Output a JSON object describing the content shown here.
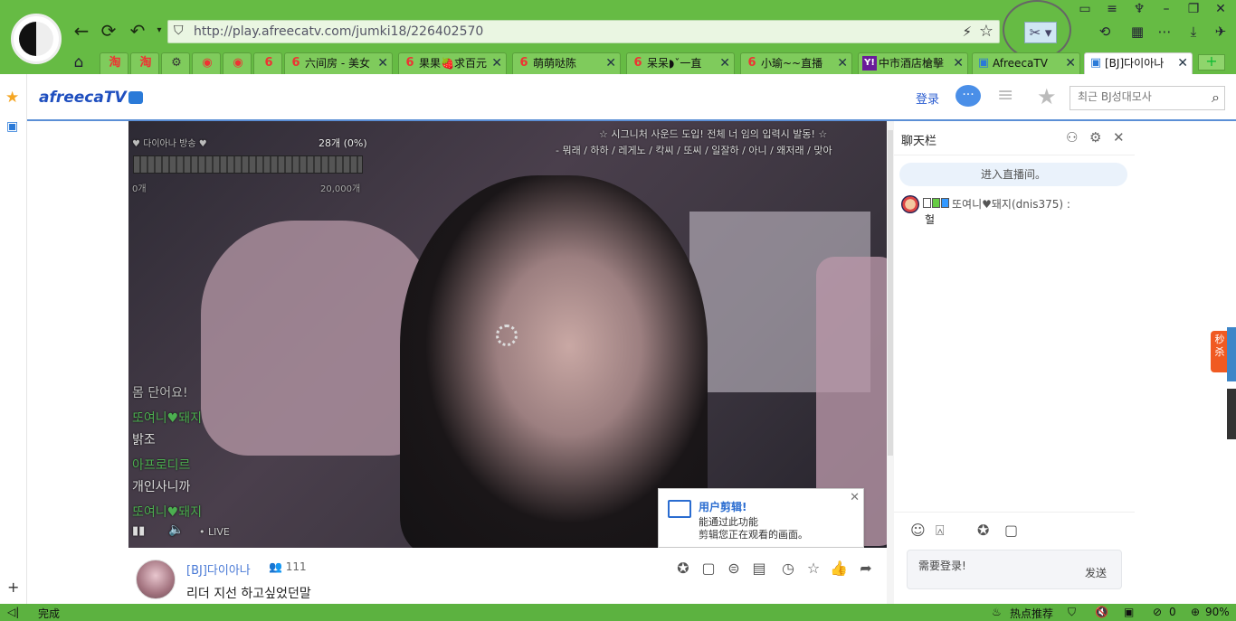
{
  "browser": {
    "url_host": "http://play.afreecatv.com",
    "url_path": "/jumki18/226402570",
    "tabs": [
      {
        "favicon": "taobao-icon",
        "label": "淘"
      },
      {
        "favicon": "taobao-icon",
        "label": "淘"
      },
      {
        "favicon": "gear-icon",
        "label": "⚙"
      },
      {
        "favicon": "weibo-icon",
        "label": "◉"
      },
      {
        "favicon": "weibo-icon",
        "label": "◉"
      },
      {
        "favicon": "six-icon",
        "label": "6"
      },
      {
        "favicon": "six-icon",
        "label": "六间房 - 美女"
      },
      {
        "favicon": "six-icon",
        "label": "果果🍓求百元"
      },
      {
        "favicon": "six-icon",
        "label": "萌萌哒陈"
      },
      {
        "favicon": "six-icon",
        "label": "呆呆◗ˇ一直"
      },
      {
        "favicon": "six-icon",
        "label": "小瑜~~直播"
      },
      {
        "favicon": "yahoo-icon",
        "label": "中市酒店槍擊"
      },
      {
        "favicon": "afreeca-icon",
        "label": "AfreecaTV"
      },
      {
        "favicon": "afreeca-icon",
        "label": "[BJ]다이아나"
      }
    ],
    "new_tab": "+"
  },
  "header": {
    "logo": "afreecaTV",
    "login": "登录",
    "search_placeholder": "최근 BJ성대모사"
  },
  "video": {
    "overlay_top": "☆ 시그니처 사운드 도입! 전체 너 임의 입력시 발동! ☆",
    "overlay_sub": "- 뭐래 / 하하 / 레게노 / 칵씨 / 또씨 / 일잘하 / 아니 / 왜저래 / 맞아",
    "goal_title": "♥ 다이아나 방송 ♥",
    "goal_count": "28개 (0%)",
    "goal_min": "0개",
    "goal_max": "20,000개",
    "chat_lines": [
      {
        "text": "몸 단어요!",
        "color": "#ccc"
      },
      {
        "text": "또여니♥돼지",
        "color": "#4caf50"
      },
      {
        "text": "밝조",
        "color": "#ddd"
      },
      {
        "text": "아프로디르",
        "color": "#4caf50"
      },
      {
        "text": "개인사니까",
        "color": "#ddd"
      },
      {
        "text": "또여니♥돼지",
        "color": "#4caf50"
      }
    ],
    "live_label": "• LIVE",
    "tooltip_title": "用户剪辑!",
    "tooltip_line1": "能通过此功能",
    "tooltip_line2": "剪辑您正在观看的画面。"
  },
  "stream": {
    "bj_name": "[BJ]다이아나",
    "viewer_count": "111",
    "title": "리더 지선 하고싶었던말"
  },
  "chat": {
    "title": "聊天栏",
    "enter_note": "进入直播间。",
    "messages": [
      {
        "user": "또여니♥돼지(dnis375) :",
        "text": "헐"
      }
    ],
    "input_placeholder": "需要登录!",
    "send": "发送"
  },
  "side_badge": "秒杀",
  "status_bar": {
    "left": "完成",
    "hot": "热点推荐",
    "count": "0",
    "zoom": "90%"
  }
}
